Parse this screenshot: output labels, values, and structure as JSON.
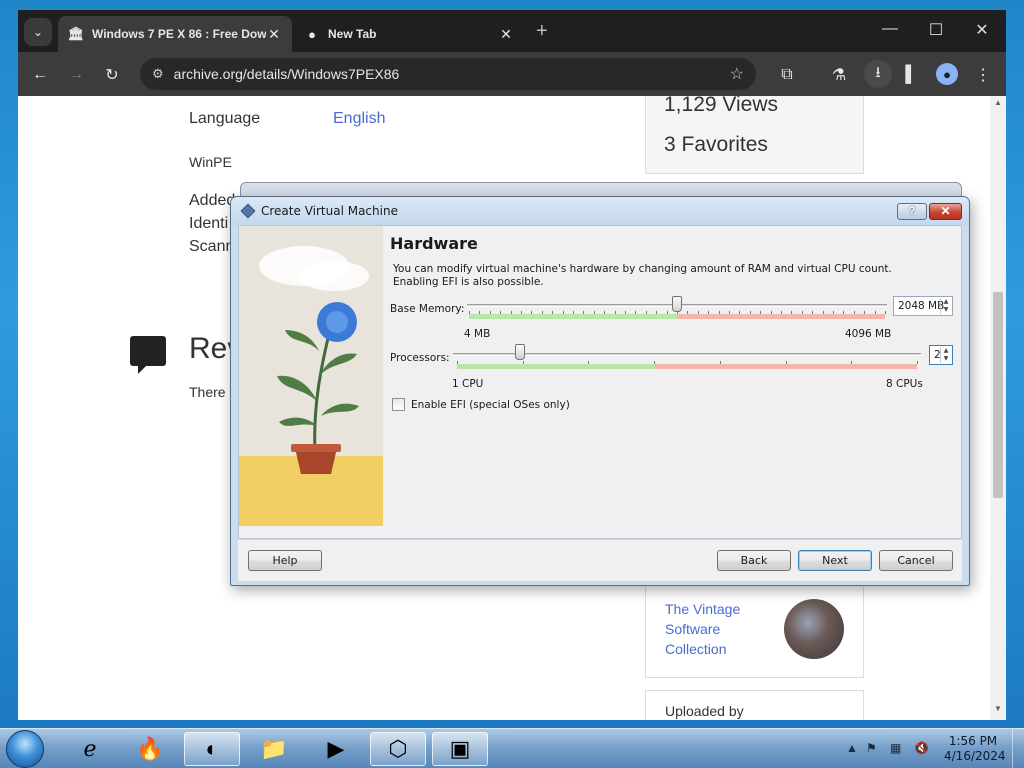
{
  "browser": {
    "tabs": [
      {
        "title": "Windows 7 PE X 86 : Free Dow",
        "icon": "archive-icon",
        "active": true
      },
      {
        "title": "New Tab",
        "icon": "chrome-icon",
        "active": false
      }
    ],
    "url": "archive.org/details/Windows7PEX86"
  },
  "page": {
    "language_label": "Language",
    "language_value": "English",
    "subject": "WinPE",
    "meta_labels": [
      "Added",
      "Identi",
      "Scann"
    ],
    "views": "1,129 Views",
    "favorites": "3 Favorites",
    "reviews_title": "Rev",
    "reviews_text": "There",
    "collection_link": "The Vintage Software Collection",
    "uploaded_by": "Uploaded by"
  },
  "dialog": {
    "title": "Create Virtual Machine",
    "help_glyph": "?",
    "close_glyph": "✕",
    "heading": "Hardware",
    "description": "You can modify virtual machine's hardware by changing amount of RAM and virtual CPU count. Enabling EFI is also possible.",
    "memory": {
      "label": "Base Memory:",
      "value": "2048 MB",
      "min_label": "4 MB",
      "max_label": "4096 MB",
      "fraction": 0.5
    },
    "processors": {
      "label": "Processors:",
      "value": "2",
      "min_label": "1 CPU",
      "max_label": "8 CPUs",
      "fraction": 0.143
    },
    "efi_label": "Enable EFI (special OSes only)",
    "buttons": {
      "help": "Help",
      "back": "Back",
      "next": "Next",
      "cancel": "Cancel"
    }
  },
  "taskbar": {
    "time": "1:56 PM",
    "date": "4/16/2024"
  },
  "colors": {
    "link": "#4a6ad0",
    "scale_green": "#b6e6a8",
    "scale_red": "#f3b6ad"
  }
}
